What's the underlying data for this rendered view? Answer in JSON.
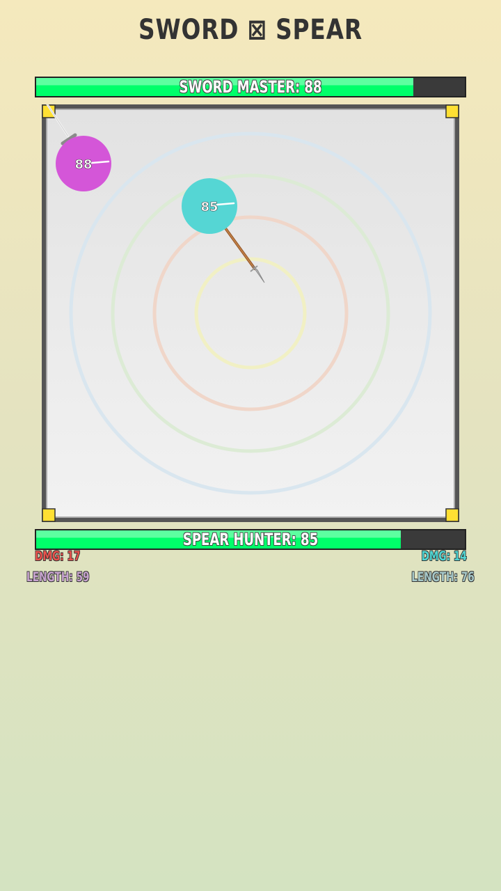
{
  "header": {
    "title": "SWORD ⊠ SPEAR"
  },
  "players": [
    {
      "name": "SWORD MASTER",
      "hp_label": "SWORD MASTER: 88",
      "hp": 88,
      "color": "#d456d8",
      "ball_label": "88",
      "weapon": "sword",
      "damage_label": "DMG: 17",
      "length_label": "LENGTH: 59",
      "stat_color": "#e9524d",
      "length_color": "#c7a4cf"
    },
    {
      "name": "SPEAR HUNTER",
      "hp_label": "SPEAR HUNTER: 85",
      "hp": 85,
      "color": "#55d6d4",
      "ball_label": "85",
      "weapon": "spear",
      "damage_label": "DMG: 14",
      "length_label": "LENGTH: 76",
      "stat_color": "#4fd6d3",
      "length_color": "#a7c9ca"
    }
  ],
  "arena": {
    "ring_colors": [
      "#d9e6ef",
      "#dcebd5",
      "#f0d6c9",
      "#f1f0c4"
    ],
    "corner_color": "#ffe033"
  },
  "colors": {
    "hp_fill": "#00ff6a",
    "hp_track": "#3a3a3a"
  }
}
